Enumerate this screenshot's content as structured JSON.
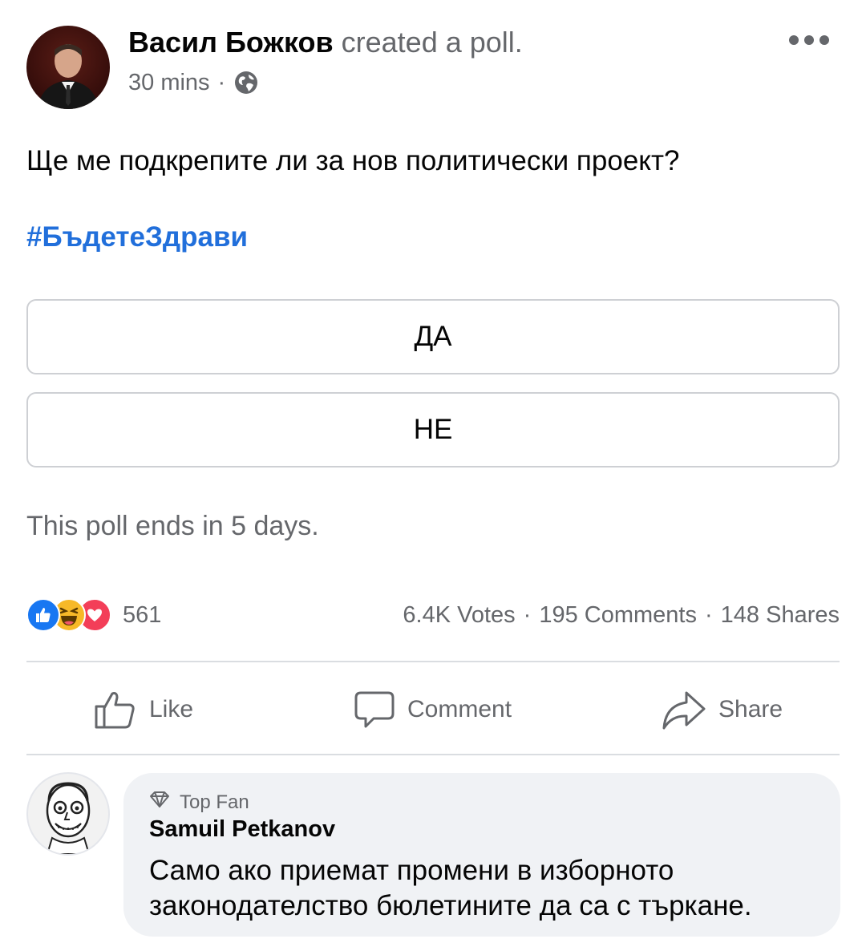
{
  "post": {
    "author_name": "Васил Божков",
    "action_text": "created a poll.",
    "time": "30 mins",
    "meta_separator": "·",
    "audience_icon": "globe-icon",
    "more_icon": "more-horizontal-icon",
    "question": "Ще ме подкрепите ли за нов политически проект?",
    "hashtag": "#БъдетеЗдрави"
  },
  "poll": {
    "options": [
      "ДА",
      "НЕ"
    ],
    "ends_text": "This poll ends in 5 days."
  },
  "engagement": {
    "reaction_icons": [
      "like-reaction-icon",
      "haha-reaction-icon",
      "love-reaction-icon"
    ],
    "reaction_count": "561",
    "votes": "6.4K Votes",
    "comments": "195 Comments",
    "shares": "148 Shares",
    "separator": "·"
  },
  "actions": {
    "like_label": "Like",
    "comment_label": "Comment",
    "share_label": "Share"
  },
  "comment": {
    "badge_icon": "diamond-icon",
    "badge": "Top Fan",
    "author": "Samuil Petkanov",
    "text": "Само ако приемат промени в изборното законодателство бюлетините да са с търкане."
  },
  "colors": {
    "link_blue": "#216fdb",
    "secondary_text": "#65676b",
    "like_blue": "#1877f2",
    "haha_yellow": "#f7b928",
    "love_red": "#f33e58",
    "bubble_bg": "#f0f2f5"
  }
}
